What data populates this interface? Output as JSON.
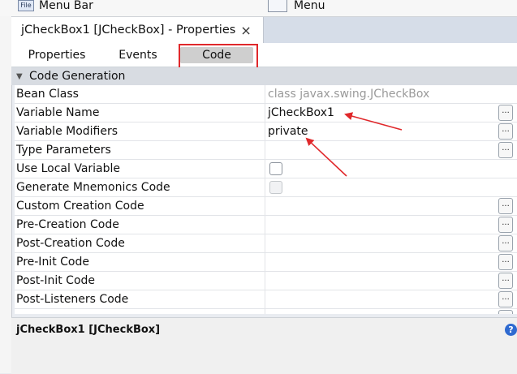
{
  "palette": {
    "item1": {
      "icon_text": "File",
      "label": "Menu Bar"
    },
    "item2": {
      "label": "Menu"
    }
  },
  "window": {
    "tab_title": "jCheckBox1 [JCheckBox] - Properties",
    "close_glyph": "×"
  },
  "subtabs": [
    {
      "label": "Properties"
    },
    {
      "label": "Events"
    },
    {
      "label": "Code",
      "active": true
    }
  ],
  "section": {
    "label": "Code Generation"
  },
  "rows": [
    {
      "name": "Bean Class",
      "value": "class javax.swing.JCheckBox",
      "value_style": "grey"
    },
    {
      "name": "Variable Name",
      "value": "jCheckBox1",
      "has_ellipsis": true
    },
    {
      "name": "Variable Modifiers",
      "value": "private",
      "has_ellipsis": true
    },
    {
      "name": "Type Parameters",
      "value": "",
      "has_ellipsis": true
    },
    {
      "name": "Use Local Variable",
      "checkbox": "unchecked"
    },
    {
      "name": "Generate Mnemonics Code",
      "checkbox": "disabled"
    },
    {
      "name": "Custom Creation Code",
      "value": "",
      "has_ellipsis": true
    },
    {
      "name": "Pre-Creation Code",
      "value": "",
      "has_ellipsis": true
    },
    {
      "name": "Post-Creation Code",
      "value": "",
      "has_ellipsis": true
    },
    {
      "name": "Pre-Init Code",
      "value": "",
      "has_ellipsis": true
    },
    {
      "name": "Post-Init Code",
      "value": "",
      "has_ellipsis": true
    },
    {
      "name": "Post-Listeners Code",
      "value": "",
      "has_ellipsis": true
    }
  ],
  "ellipsis_label": "...",
  "description": {
    "title": "jCheckBox1 [JCheckBox]",
    "help_glyph": "?"
  },
  "colors": {
    "annotation_red": "#e0282b",
    "help_blue": "#2f6ad0"
  }
}
